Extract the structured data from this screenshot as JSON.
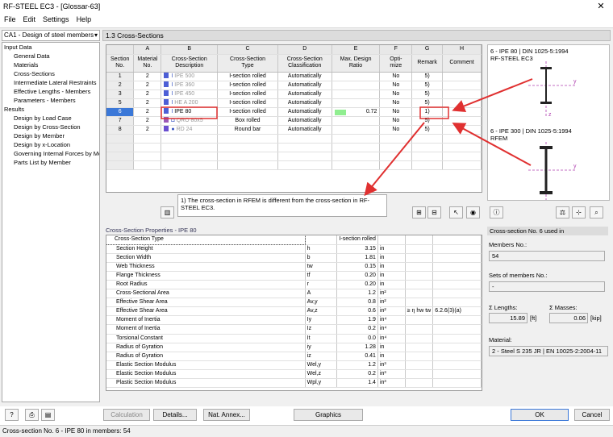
{
  "window": {
    "title": "RF-STEEL EC3 - [Glossar-63]",
    "close": "✕"
  },
  "menu": [
    "File",
    "Edit",
    "Settings",
    "Help"
  ],
  "case_combo": "CA1 - Design of steel members",
  "nav": {
    "input_data": "Input Data",
    "input_items": [
      "General Data",
      "Materials",
      "Cross-Sections",
      "Intermediate Lateral Restraints",
      "Effective Lengths - Members",
      "Parameters - Members"
    ],
    "results": "Results",
    "result_items": [
      "Design by Load Case",
      "Design by Cross-Section",
      "Design by Member",
      "Design by x-Location",
      "Governing Internal Forces by Member",
      "Parts List by Member"
    ]
  },
  "section_header": "1.3 Cross-Sections",
  "grid": {
    "col_letters": [
      "A",
      "B",
      "C",
      "D",
      "E",
      "F",
      "G",
      "H"
    ],
    "headers": [
      [
        "Section",
        "No."
      ],
      [
        "Material",
        "No."
      ],
      [
        "Cross-Section",
        "Description"
      ],
      [
        "Cross-Section",
        "Type"
      ],
      [
        "Cross-Section",
        "Classification"
      ],
      [
        "Max. Design",
        "Ratio"
      ],
      [
        "Opti-",
        "mize"
      ],
      [
        "",
        "Remark"
      ],
      [
        "",
        "Comment"
      ]
    ],
    "rows": [
      {
        "no": "1",
        "mat": "2",
        "desc": "IPE 500",
        "type": "I-section rolled",
        "cls": "Automatically",
        "ratio": "",
        "opt": "No",
        "rem": "5)",
        "color": "#4d5fd6",
        "icon": "I",
        "gray": true
      },
      {
        "no": "2",
        "mat": "2",
        "desc": "IPE 360",
        "type": "I-section rolled",
        "cls": "Automatically",
        "ratio": "",
        "opt": "No",
        "rem": "5)",
        "color": "#4d5fd6",
        "icon": "I",
        "gray": true
      },
      {
        "no": "3",
        "mat": "2",
        "desc": "IPE 450",
        "type": "I-section rolled",
        "cls": "Automatically",
        "ratio": "",
        "opt": "No",
        "rem": "5)",
        "color": "#4d5fd6",
        "icon": "I",
        "gray": true
      },
      {
        "no": "5",
        "mat": "2",
        "desc": "HE A 200",
        "type": "I-section rolled",
        "cls": "Automatically",
        "ratio": "",
        "opt": "No",
        "rem": "5)",
        "color": "#4d5fd6",
        "icon": "I",
        "gray": true
      },
      {
        "no": "6",
        "mat": "2",
        "desc": "IPE 80",
        "type": "I-section rolled",
        "cls": "Automatically",
        "ratio": "0.72",
        "opt": "No",
        "rem": "1)",
        "color": "#4d5fd6",
        "icon": "I",
        "gray": false
      },
      {
        "no": "7",
        "mat": "2",
        "desc": "QRO 80x5",
        "type": "Box rolled",
        "cls": "Automatically",
        "ratio": "",
        "opt": "No",
        "rem": "5)",
        "color": "#9b59b6",
        "icon": "◘",
        "gray": true
      },
      {
        "no": "8",
        "mat": "2",
        "desc": "RD 24",
        "type": "Round bar",
        "cls": "Automatically",
        "ratio": "",
        "opt": "No",
        "rem": "5)",
        "color": "#6a4fd0",
        "icon": "●",
        "gray": true
      }
    ],
    "ratio_fill": 0.72
  },
  "note": "1) The cross-section in RFEM is different from the cross-section in RF-STEEL EC3.",
  "preview": {
    "top_label": "6 - IPE 80 | DIN 1025-5:1994",
    "top_sub": "RF-STEEL EC3",
    "bottom_label": "6 - IPE 300 | DIN 1025-5:1994",
    "bottom_sub": "RFEM",
    "axis_y": "y",
    "axis_z": "z"
  },
  "props": {
    "header": "Cross-Section Properties  -  IPE 80",
    "rows": [
      {
        "name": "Cross-Section Type",
        "sym": "",
        "val": "I-section rolled",
        "unit": "",
        "extra": "",
        "ref": ""
      },
      {
        "name": "Section Height",
        "sym": "h",
        "val": "3.15",
        "unit": "in",
        "extra": "",
        "ref": ""
      },
      {
        "name": "Section Width",
        "sym": "b",
        "val": "1.81",
        "unit": "in",
        "extra": "",
        "ref": ""
      },
      {
        "name": "Web Thickness",
        "sym": "tw",
        "val": "0.15",
        "unit": "in",
        "extra": "",
        "ref": ""
      },
      {
        "name": "Flange Thickness",
        "sym": "tf",
        "val": "0.20",
        "unit": "in",
        "extra": "",
        "ref": ""
      },
      {
        "name": "Root Radius",
        "sym": "r",
        "val": "0.20",
        "unit": "in",
        "extra": "",
        "ref": ""
      },
      {
        "name": "Cross-Sectional Area",
        "sym": "A",
        "val": "1.2",
        "unit": "in²",
        "extra": "",
        "ref": ""
      },
      {
        "name": "Effective Shear Area",
        "sym": "Av,y",
        "val": "0.8",
        "unit": "in²",
        "extra": "",
        "ref": ""
      },
      {
        "name": "Effective Shear Area",
        "sym": "Av,z",
        "val": "0.6",
        "unit": "in²",
        "extra": "≥ η hw tw",
        "ref": "6.2.6(3)(a)"
      },
      {
        "name": "Moment of Inertia",
        "sym": "Iy",
        "val": "1.9",
        "unit": "in⁴",
        "extra": "",
        "ref": ""
      },
      {
        "name": "Moment of Inertia",
        "sym": "Iz",
        "val": "0.2",
        "unit": "in⁴",
        "extra": "",
        "ref": ""
      },
      {
        "name": "Torsional Constant",
        "sym": "It",
        "val": "0.0",
        "unit": "in⁴",
        "extra": "",
        "ref": ""
      },
      {
        "name": "Radius of Gyration",
        "sym": "iy",
        "val": "1.28",
        "unit": "in",
        "extra": "",
        "ref": ""
      },
      {
        "name": "Radius of Gyration",
        "sym": "iz",
        "val": "0.41",
        "unit": "in",
        "extra": "",
        "ref": ""
      },
      {
        "name": "Elastic Section Modulus",
        "sym": "Wel,y",
        "val": "1.2",
        "unit": "in³",
        "extra": "",
        "ref": ""
      },
      {
        "name": "Elastic Section Modulus",
        "sym": "Wel,z",
        "val": "0.2",
        "unit": "in³",
        "extra": "",
        "ref": ""
      },
      {
        "name": "Plastic Section Modulus",
        "sym": "Wpl,y",
        "val": "1.4",
        "unit": "in³",
        "extra": "",
        "ref": ""
      }
    ]
  },
  "info": {
    "header": "Cross-section No. 6 used in",
    "members_label": "Members No.:",
    "members_value": "54",
    "sets_label": "Sets of members No.:",
    "sets_value": "-",
    "lengths_label": "Σ Lengths:",
    "lengths_value": "15.89",
    "lengths_unit": "[ft]",
    "masses_label": "Σ Masses:",
    "masses_value": "0.06",
    "masses_unit": "[kip]",
    "material_label": "Material:",
    "material_value": "2 - Steel S 235 JR | EN 10025-2:2004-11"
  },
  "buttons": {
    "calculation": "Calculation",
    "details": "Details...",
    "nat_annex": "Nat. Annex...",
    "graphics": "Graphics",
    "ok": "OK",
    "cancel": "Cancel"
  },
  "status": "Cross-section No. 6 - IPE 80 in members: 54",
  "colors": {
    "accent": "#3b78d8",
    "arrow": "#e03030",
    "highlight": "#e03030",
    "ratio_bar": "#90ee90"
  }
}
